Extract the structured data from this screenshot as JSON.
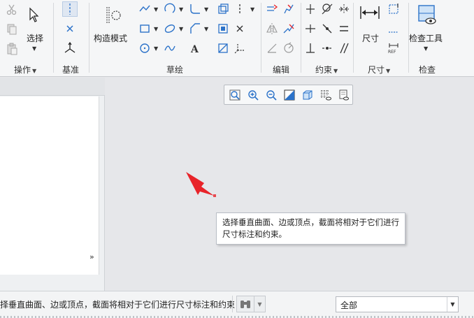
{
  "ribbon": {
    "groups": {
      "operations": "操作",
      "datum": "基准",
      "sketch": "草绘",
      "edit": "编辑",
      "constraint": "约束",
      "dimension": "尺寸",
      "inspect": "检查"
    },
    "buttons": {
      "select": "选择",
      "construction_mode": "构造模式",
      "dimension": "尺寸",
      "inspect_tool": "检查工具"
    }
  },
  "canvas": {
    "tooltip": "选择垂直曲面、边或顶点，截面将相对于它们进行尺寸标注和约束。"
  },
  "status": {
    "message": "择垂直曲面、边或顶点，截面将相对于它们进行尺寸标注和约束",
    "filter_value": "全部"
  },
  "colors": {
    "accent": "#1a6fc4",
    "arrow": "#e8242a",
    "icon_blue": "#2b72c9"
  }
}
